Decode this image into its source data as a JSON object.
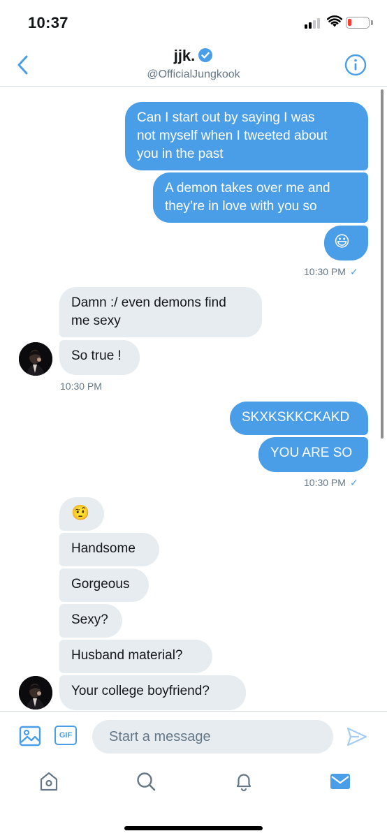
{
  "status_bar": {
    "time": "10:37"
  },
  "header": {
    "name": "jjk.",
    "handle": "@OfficialJungkook",
    "verified": true,
    "back_icon": "chevron-left-icon",
    "info_icon": "info-circle-icon"
  },
  "messages": {
    "sent_group_1": [
      "Can I start out by saying I was",
      "not myself when I tweeted about",
      "you in the past",
      "A demon takes over me and",
      "they’re in love with you so",
      "😃"
    ],
    "sent_group_1_time": "10:30 PM",
    "received_group_1": [
      "Damn :/ even demons find",
      "me sexy",
      "So true !"
    ],
    "received_group_1_time": "10:30 PM",
    "sent_group_2": [
      "SKXKSKKCKAKD",
      "YOU ARE SO"
    ],
    "sent_group_2_time": "10:30 PM",
    "received_group_2": [
      "🤨",
      "Handsome",
      "Gorgeous",
      "Sexy?",
      "Husband material?",
      "Your college boyfriend?"
    ],
    "read_check": "✓"
  },
  "composer": {
    "placeholder": "Start a message",
    "gif_label": "GIF"
  },
  "tabs": [
    "home-icon",
    "search-icon",
    "notifications-icon",
    "messages-icon"
  ],
  "colors": {
    "accent": "#4a9ee8",
    "received_bubble": "#e6ecf0",
    "muted_text": "#657786"
  }
}
